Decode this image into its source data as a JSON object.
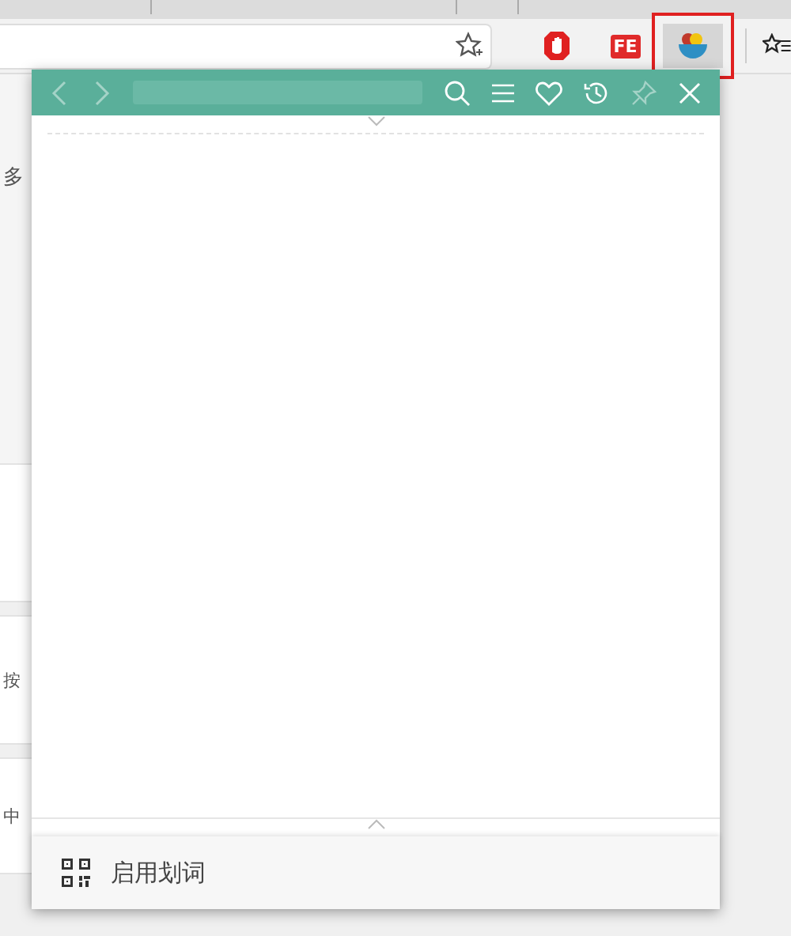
{
  "extensions": [
    {
      "kind": "hand",
      "selected": false
    },
    {
      "kind": "badge",
      "label": "FE",
      "selected": false
    },
    {
      "kind": "bowl",
      "selected": true
    }
  ],
  "page_snippets": [
    "多",
    "按",
    "中"
  ],
  "popup": {
    "header_buttons": [
      {
        "kind": "back",
        "disabled": true
      },
      {
        "kind": "forward",
        "disabled": true
      },
      {
        "kind": "field"
      },
      {
        "kind": "search",
        "disabled": false
      },
      {
        "kind": "menu",
        "disabled": false
      },
      {
        "kind": "heart",
        "disabled": false
      },
      {
        "kind": "history",
        "disabled": false
      },
      {
        "kind": "pin",
        "disabled": true
      },
      {
        "kind": "close",
        "disabled": false
      }
    ],
    "footer": {
      "label": "启用划词"
    }
  }
}
